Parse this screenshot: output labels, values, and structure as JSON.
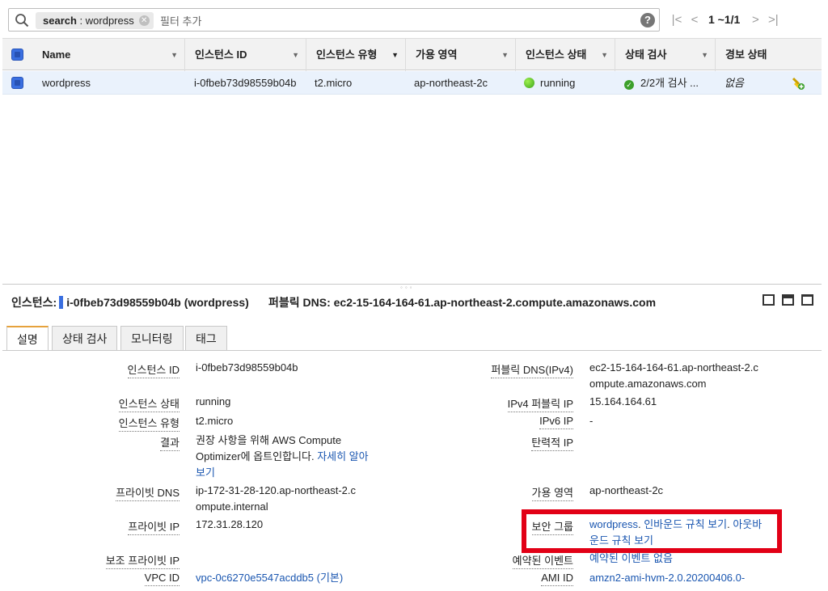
{
  "search": {
    "token_key": "search",
    "token_value": "wordpress",
    "filter_placeholder": "필터 추가",
    "help": "?"
  },
  "pager": {
    "text": "1 ~1/1"
  },
  "table": {
    "headers": [
      "Name",
      "인스턴스 ID",
      "인스턴스 유형",
      "가용 영역",
      "인스턴스 상태",
      "상태 검사",
      "경보 상태"
    ],
    "row": {
      "name": "wordpress",
      "instance_id": "i-0fbeb73d98559b04b",
      "instance_type": "t2.micro",
      "availability_zone": "ap-northeast-2c",
      "state": "running",
      "status_check": "2/2개 검사 ...",
      "alarm_status": "없음"
    }
  },
  "detail": {
    "title_label": "인스턴스:",
    "title_value": "i-0fbeb73d98559b04b (wordpress)",
    "public_dns_header": "퍼블릭 DNS: ec2-15-164-164-61.ap-northeast-2.compute.amazonaws.com",
    "tabs": [
      "설명",
      "상태 검사",
      "모니터링",
      "태그"
    ],
    "left_fields": [
      {
        "label": "인스턴스 ID",
        "value": "i-0fbeb73d98559b04b"
      },
      {
        "label": "인스턴스 상태",
        "value": "running"
      },
      {
        "label": "인스턴스 유형",
        "value": "t2.micro"
      },
      {
        "label": "결과",
        "value": "권장 사항을 위해 AWS Compute Optimizer에 옵트인합니다.",
        "link": "자세히 알아보기"
      },
      {
        "label": "프라이빗 DNS",
        "value": "ip-172-31-28-120.ap-northeast-2.compute.internal"
      },
      {
        "label": "프라이빗 IP",
        "value": "172.31.28.120"
      },
      {
        "label": "보조 프라이빗 IP",
        "value": ""
      },
      {
        "label": "VPC ID",
        "value": "vpc-0c6270e5547acddb5 (기본)"
      }
    ],
    "right_fields": [
      {
        "label": "퍼블릭 DNS(IPv4)",
        "value": "ec2-15-164-164-61.ap-northeast-2.compute.amazonaws.com"
      },
      {
        "label": "IPv4 퍼블릭 IP",
        "value": "15.164.164.61"
      },
      {
        "label": "IPv6 IP",
        "value": "-"
      },
      {
        "label": "탄력적 IP",
        "value": ""
      },
      {
        "label": "가용 영역",
        "value": "ap-northeast-2c"
      },
      {
        "label": "보안 그룹",
        "value_link": "wordpress",
        "sep1": ". ",
        "inbound": "인바운드 규칙 보기",
        "sep2": ". ",
        "outbound": "아웃바운드 규칙 보기"
      },
      {
        "label": "예약된 이벤트",
        "value": "예약된 이벤트 없음"
      },
      {
        "label": "AMI ID",
        "value": "amzn2-ami-hvm-2.0.20200406.0-"
      }
    ]
  },
  "colors": {
    "highlight": "#e20016",
    "link": "#1a56b0",
    "accent_tab": "#e6a23c",
    "selected_row": "#eaf2fc"
  }
}
